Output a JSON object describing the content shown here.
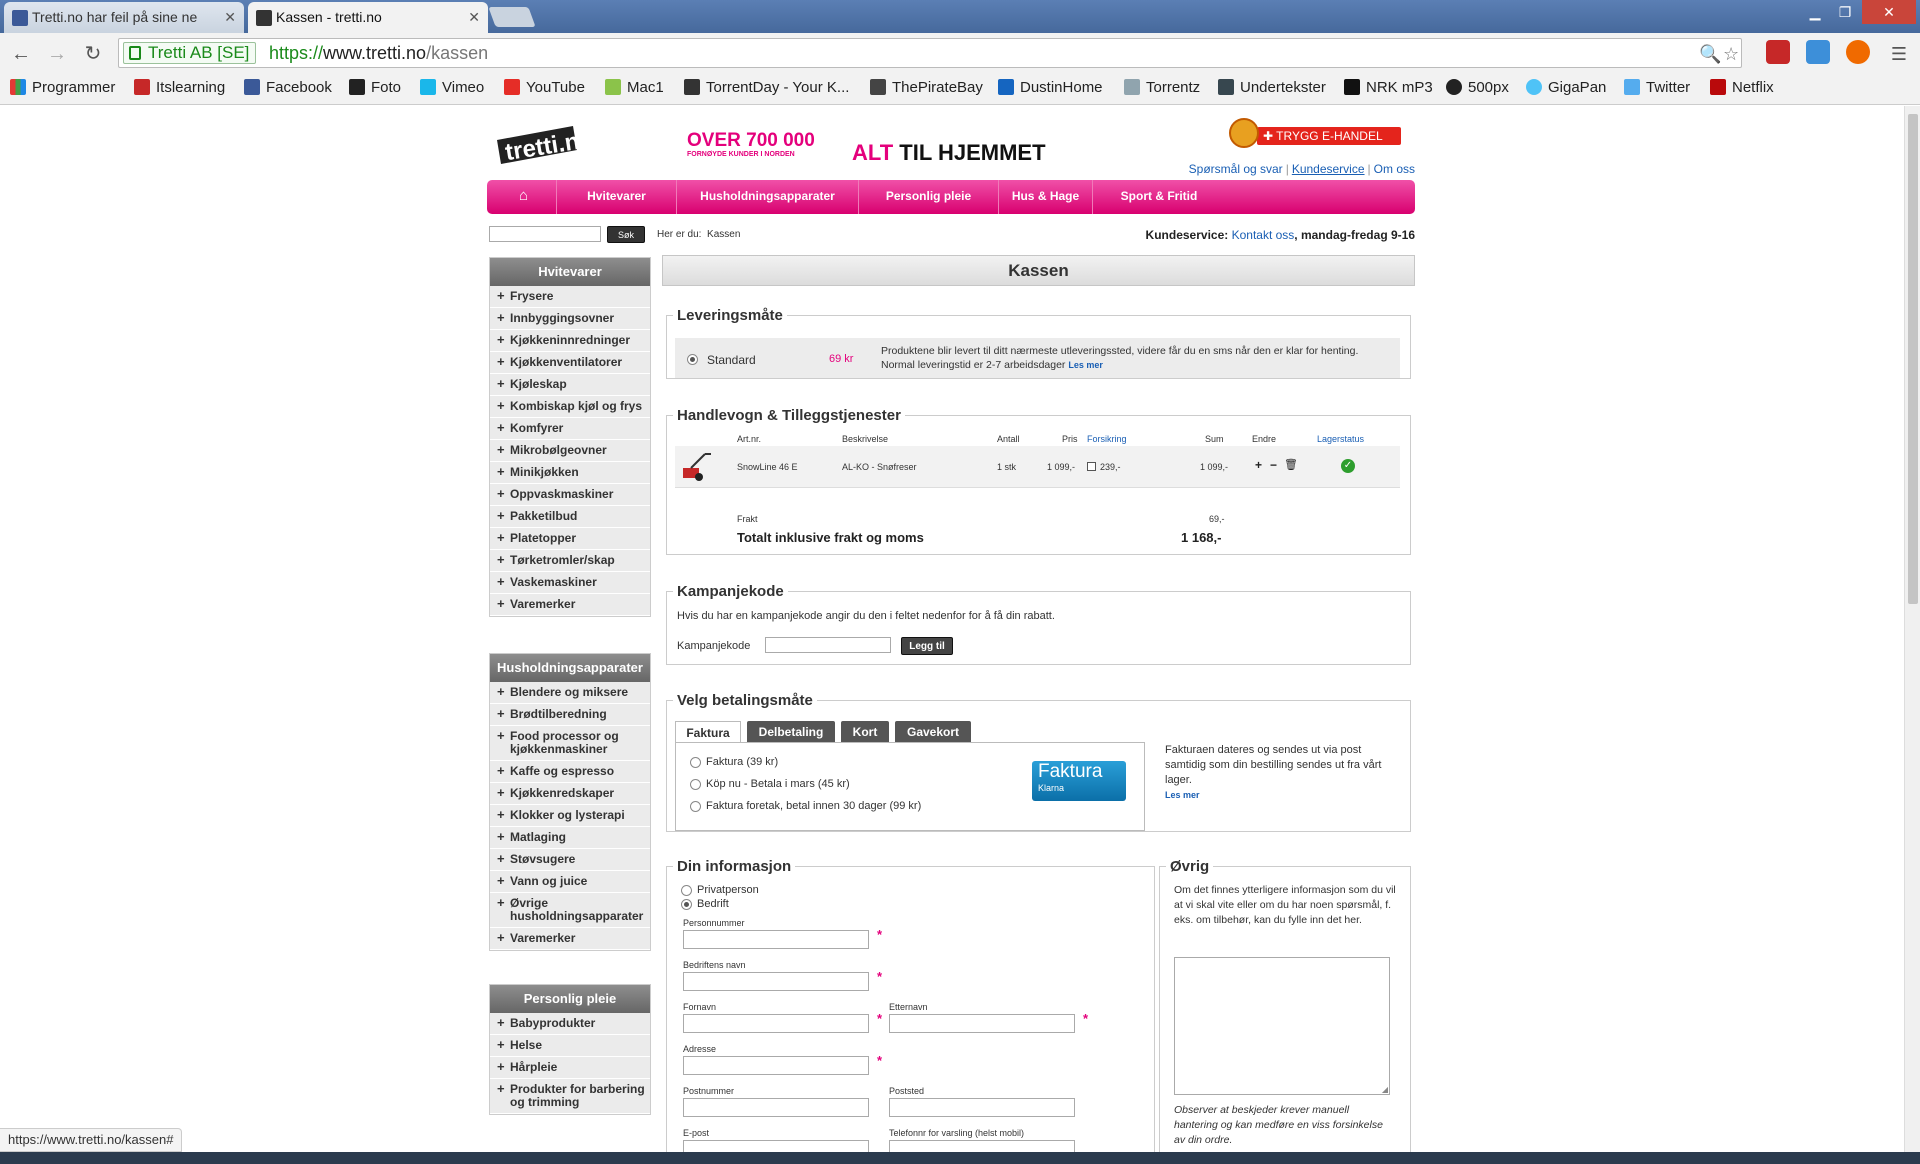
{
  "browser": {
    "tabs": [
      {
        "title": "Tretti.no har feil på sine ne",
        "active": false
      },
      {
        "title": "Kassen - tretti.no",
        "active": true
      }
    ],
    "secure_label": "Tretti AB [SE]",
    "url_scheme": "https://",
    "url_host": "www.tretti.no",
    "url_path": "/kassen",
    "status_url": "https://www.tretti.no/kassen#",
    "bookmarks": [
      "Programmer",
      "Itslearning",
      "Facebook",
      "Foto",
      "Vimeo",
      "YouTube",
      "Mac1",
      "TorrentDay - Your K...",
      "ThePirateBay",
      "DustinHome",
      "Torrentz",
      "Undertekster",
      "NRK mP3",
      "500px",
      "GigaPan",
      "Twitter",
      "Netflix"
    ]
  },
  "page": {
    "logo": "tretti.no",
    "promo_big": "OVER 700 000",
    "promo_small": "FORNØYDE KUNDER I NORDEN",
    "promo_alt": "ALT",
    "promo_hjemmet": "TIL HJEMMET",
    "trygg": "TRYGG E-HANDEL",
    "toplinks": [
      "Spørsmål og svar",
      "Kundeservice",
      "Om oss"
    ],
    "nav": [
      "Hvitevarer",
      "Husholdningsapparater",
      "Personlig pleie",
      "Hus & Hage",
      "Sport & Fritid"
    ],
    "search_btn": "Søk",
    "crumb_label": "Her er du:",
    "crumb_value": "Kassen",
    "kunde_label": "Kundeservice:",
    "kunde_link": "Kontakt oss",
    "kunde_hours": ", mandag-fredag 9-16"
  },
  "sidebar": {
    "hvitevarer": {
      "title": "Hvitevarer",
      "items": [
        "Frysere",
        "Innbyggingsovner",
        "Kjøkkeninnredninger",
        "Kjøkkenventilatorer",
        "Kjøleskap",
        "Kombiskap kjøl og frys",
        "Komfyrer",
        "Mikrobølgeovner",
        "Minikjøkken",
        "Oppvaskmaskiner",
        "Pakketilbud",
        "Platetopper",
        "Tørketromler/skap",
        "Vaskemaskiner",
        "Varemerker"
      ]
    },
    "husholdning": {
      "title": "Husholdningsapparater",
      "items": [
        "Blendere og miksere",
        "Brødtilberedning",
        "Food processor og kjøkkenmaskiner",
        "Kaffe og espresso",
        "Kjøkkenredskaper",
        "Klokker og lysterapi",
        "Matlaging",
        "Støvsugere",
        "Vann og juice",
        "Øvrige husholdningsapparater",
        "Varemerker"
      ]
    },
    "pleie": {
      "title": "Personlig pleie",
      "items": [
        "Babyprodukter",
        "Helse",
        "Hårpleie",
        "Produkter for barbering og trimming"
      ]
    }
  },
  "checkout": {
    "title": "Kassen",
    "levering": {
      "legend": "Leveringsmåte",
      "option": "Standard",
      "price": "69 kr",
      "desc": "Produktene blir levert til ditt nærmeste utleveringssted, videre får du en sms når den er klar for henting. Normal leveringstid er 2-7 arbeidsdager",
      "more": "Les mer"
    },
    "cart": {
      "legend": "Handlevogn & Tilleggstjenester",
      "headers": {
        "artnr": "Art.nr.",
        "beskr": "Beskrivelse",
        "antall": "Antall",
        "pris": "Pris",
        "forsikring": "Forsikring",
        "sum": "Sum",
        "endre": "Endre",
        "lager": "Lagerstatus"
      },
      "row": {
        "artnr": "SnowLine 46 E",
        "beskr": "AL-KO - Snøfreser",
        "antall": "1 stk",
        "pris": "1 099,-",
        "forsikring": "239,-",
        "sum": "1 099,-"
      },
      "frakt_label": "Frakt",
      "frakt_value": "69,-",
      "total_label": "Totalt inklusive frakt og moms",
      "total_value": "1 168,-"
    },
    "kampanje": {
      "legend": "Kampanjekode",
      "text": "Hvis du har en kampanjekode angir du den i feltet nedenfor for å få din rabatt.",
      "label": "Kampanjekode",
      "btn": "Legg til"
    },
    "betaling": {
      "legend": "Velg betalingsmåte",
      "tabs": [
        "Faktura",
        "Delbetaling",
        "Kort",
        "Gavekort"
      ],
      "options": [
        "Faktura (39 kr)",
        "Köp nu - Betala i mars (45 kr)",
        "Faktura foretak, betal innen 30 dager (99 kr)"
      ],
      "klarna_big": "Faktura",
      "klarna_small": "Klarna",
      "info": "Fakturaen dateres og sendes ut via post samtidig som din bestilling sendes ut fra vårt lager.",
      "more": "Les mer"
    },
    "info": {
      "legend": "Din informasjon",
      "privat": "Privatperson",
      "bedrift": "Bedrift",
      "fields": {
        "personnr": "Personnummer",
        "bedrift_navn": "Bedriftens navn",
        "fornavn": "Fornavn",
        "etternavn": "Etternavn",
        "adresse": "Adresse",
        "postnr": "Postnummer",
        "poststed": "Poststed",
        "epost": "E-post",
        "telefon": "Telefonnr for varsling (helst mobil)"
      }
    },
    "ovrig": {
      "legend": "Øvrig",
      "text": "Om det finnes ytterligere informasjon som du vil at vi skal vite eller om du har noen spørsmål, f. eks. om tilbehør, kan du fylle inn det her.",
      "note": "Observer at beskjeder krever manuell hantering og kan medføre en viss forsinkelse av din ordre."
    }
  }
}
